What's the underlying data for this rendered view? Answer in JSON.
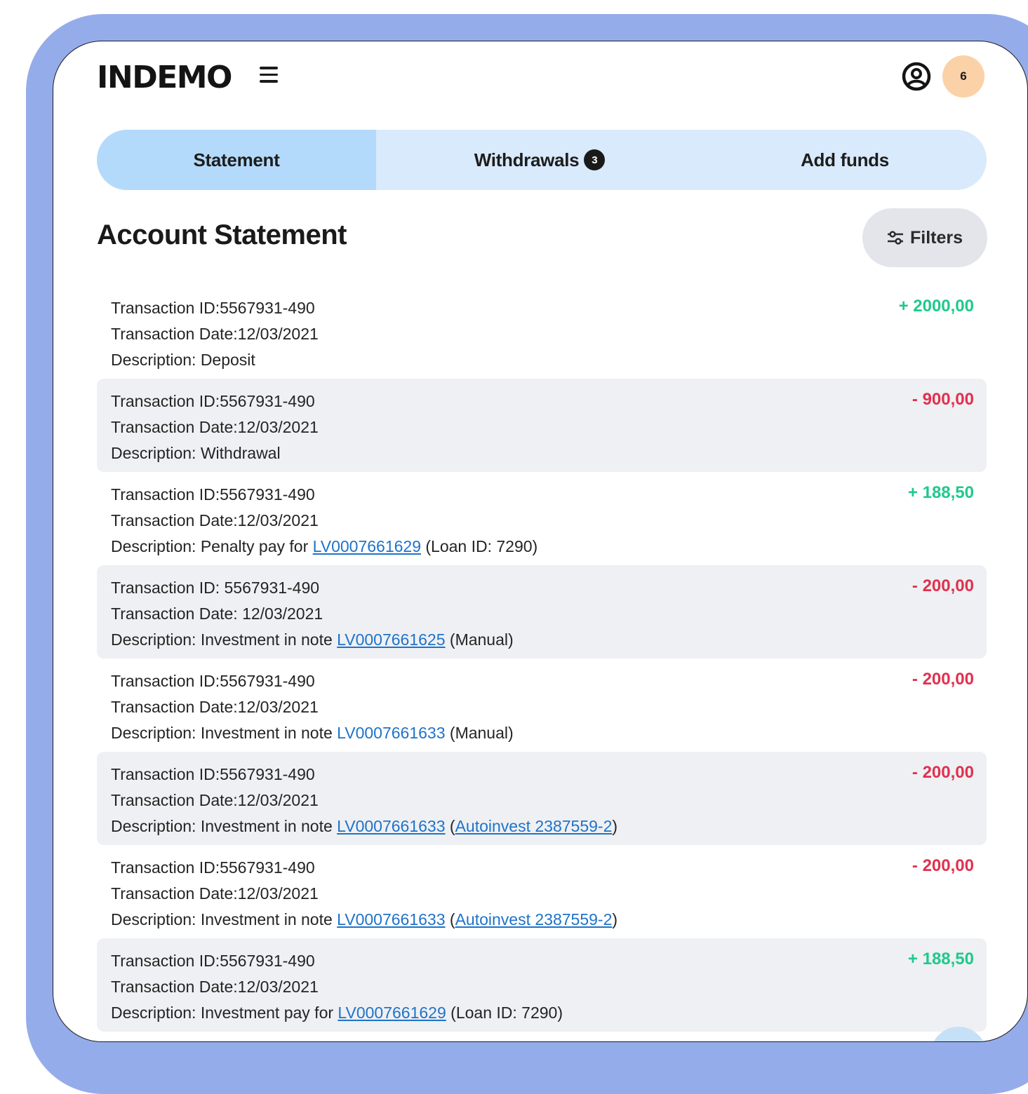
{
  "header": {
    "logo": "INDEMO",
    "notification_count": "6"
  },
  "tabs": [
    {
      "label": "Statement",
      "active": true
    },
    {
      "label": "Withdrawals",
      "badge": "3"
    },
    {
      "label": "Add funds"
    }
  ],
  "page_title": "Account Statement",
  "filters_label": "Filters",
  "colors": {
    "frame": "#95acea",
    "positive": "#1fc98b",
    "negative": "#e0314f",
    "link": "#1f73c9",
    "tab_active": "#b4dafb",
    "tab_bg": "#d8eafb"
  },
  "transactions": [
    {
      "id_text": "Transaction ID:5567931-490",
      "date_text": "Transaction Date:12/03/2021",
      "desc_prefix": "Description: Deposit",
      "amount": "+ 2000,00",
      "sign": "pos"
    },
    {
      "id_text": "Transaction ID:5567931-490",
      "date_text": "Transaction Date:12/03/2021",
      "desc_prefix": "Description: Withdrawal",
      "amount": "- 900,00",
      "sign": "neg"
    },
    {
      "id_text": "Transaction ID:5567931-490",
      "date_text": "Transaction Date:12/03/2021",
      "desc_prefix": "Description: Penalty pay for ",
      "link1": "LV0007661629",
      "mid": " (Loan ID: 7290)",
      "amount": "+ 188,50",
      "sign": "pos"
    },
    {
      "id_text": "Transaction ID: 5567931-490",
      "date_text": "Transaction Date: 12/03/2021",
      "desc_prefix": "Description: Investment in note ",
      "link1": "LV0007661625",
      "mid": " (Manual)",
      "amount": "- 200,00",
      "sign": "neg"
    },
    {
      "id_text": "Transaction ID:5567931-490",
      "date_text": "Transaction Date:12/03/2021",
      "desc_prefix": "Description: Investment in note ",
      "link1": "LV0007661633",
      "mid": " (Manual)",
      "amount": "- 200,00",
      "sign": "neg"
    },
    {
      "id_text": "Transaction ID:5567931-490",
      "date_text": "Transaction Date:12/03/2021",
      "desc_prefix": "Description: Investment in note ",
      "link1": "LV0007661633",
      "mid": " (",
      "link2": "Autoinvest 2387559-2",
      "suffix": ")",
      "amount": "- 200,00",
      "sign": "neg"
    },
    {
      "id_text": "Transaction ID:5567931-490",
      "date_text": "Transaction Date:12/03/2021",
      "desc_prefix": "Description: Investment in note ",
      "link1": "LV0007661633",
      "mid": " (",
      "link2": "Autoinvest 2387559-2",
      "suffix": ")",
      "amount": "- 200,00",
      "sign": "neg"
    },
    {
      "id_text": "Transaction ID:5567931-490",
      "date_text": "Transaction Date:12/03/2021",
      "desc_prefix": "Description: Investment pay for ",
      "link1": "LV0007661629",
      "mid": " (Loan ID: 7290)",
      "amount": "+ 188,50",
      "sign": "pos"
    }
  ]
}
